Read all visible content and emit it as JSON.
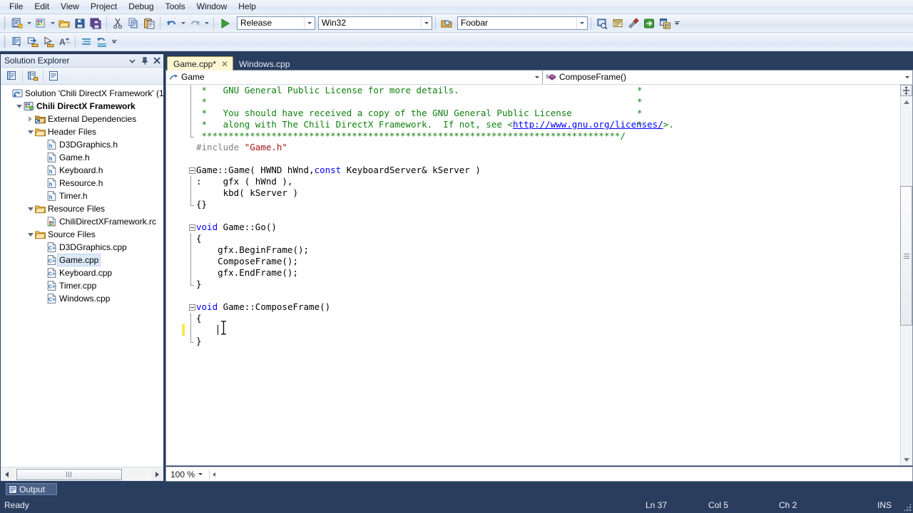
{
  "menu": {
    "items": [
      "File",
      "Edit",
      "View",
      "Project",
      "Debug",
      "Tools",
      "Window",
      "Help"
    ]
  },
  "toolbar": {
    "config_combo": "Release",
    "platform_combo": "Win32",
    "target_combo": "Foobar",
    "icons": [
      "new-project-icon",
      "add-new-item-icon",
      "open-file-icon",
      "save-icon",
      "save-all-icon",
      "cut-icon",
      "copy-icon",
      "paste-icon",
      "undo-icon",
      "redo-icon",
      "start-debug-icon",
      "find-in-files-icon",
      "properties-window-icon",
      "tools-icon",
      "go-to-icon",
      "toolbox-icon"
    ],
    "row2_icons": [
      "display-members-icon",
      "insert-snippet-icon",
      "surround-with-icon",
      "uncomment-icon",
      "comment-out-icon",
      "increase-indent-icon",
      "decrease-indent-icon"
    ]
  },
  "solution_explorer": {
    "title": "Solution Explorer",
    "window_buttons": [
      "dropdown-menu-icon",
      "pin-icon",
      "close-icon"
    ],
    "toolbar_icons": [
      "properties-icon",
      "show-all-files-icon",
      "view-code-icon"
    ],
    "tree": [
      {
        "label": "Solution 'Chili DirectX Framework' (1",
        "indent": 0,
        "expander": "none",
        "icon": "solution-icon",
        "bold": false,
        "selected": false
      },
      {
        "label": "Chili DirectX Framework",
        "indent": 1,
        "expander": "open",
        "icon": "project-icon",
        "bold": true,
        "selected": false
      },
      {
        "label": "External Dependencies",
        "indent": 2,
        "expander": "closed",
        "icon": "external-deps-folder-icon",
        "bold": false,
        "selected": false
      },
      {
        "label": "Header Files",
        "indent": 2,
        "expander": "open",
        "icon": "folder-icon",
        "bold": false,
        "selected": false
      },
      {
        "label": "D3DGraphics.h",
        "indent": 3,
        "expander": "none",
        "icon": "header-file-icon",
        "bold": false,
        "selected": false
      },
      {
        "label": "Game.h",
        "indent": 3,
        "expander": "none",
        "icon": "header-file-icon",
        "bold": false,
        "selected": false
      },
      {
        "label": "Keyboard.h",
        "indent": 3,
        "expander": "none",
        "icon": "header-file-icon",
        "bold": false,
        "selected": false
      },
      {
        "label": "Resource.h",
        "indent": 3,
        "expander": "none",
        "icon": "header-file-icon",
        "bold": false,
        "selected": false
      },
      {
        "label": "Timer.h",
        "indent": 3,
        "expander": "none",
        "icon": "header-file-icon",
        "bold": false,
        "selected": false
      },
      {
        "label": "Resource Files",
        "indent": 2,
        "expander": "open",
        "icon": "folder-icon",
        "bold": false,
        "selected": false
      },
      {
        "label": "ChiliDirectXFramework.rc",
        "indent": 3,
        "expander": "none",
        "icon": "resource-file-icon",
        "bold": false,
        "selected": false
      },
      {
        "label": "Source Files",
        "indent": 2,
        "expander": "open",
        "icon": "folder-icon",
        "bold": false,
        "selected": false
      },
      {
        "label": "D3DGraphics.cpp",
        "indent": 3,
        "expander": "none",
        "icon": "cpp-file-icon",
        "bold": false,
        "selected": false
      },
      {
        "label": "Game.cpp",
        "indent": 3,
        "expander": "none",
        "icon": "cpp-file-icon",
        "bold": false,
        "selected": true
      },
      {
        "label": "Keyboard.cpp",
        "indent": 3,
        "expander": "none",
        "icon": "cpp-file-icon",
        "bold": false,
        "selected": false
      },
      {
        "label": "Timer.cpp",
        "indent": 3,
        "expander": "none",
        "icon": "cpp-file-icon",
        "bold": false,
        "selected": false
      },
      {
        "label": "Windows.cpp",
        "indent": 3,
        "expander": "none",
        "icon": "cpp-file-icon",
        "bold": false,
        "selected": false
      }
    ]
  },
  "editor": {
    "tabs": [
      {
        "label": "Game.cpp*",
        "active": true,
        "closeable": true
      },
      {
        "label": "Windows.cpp",
        "active": false,
        "closeable": false
      }
    ],
    "close_glyph": "✕",
    "nav_scope": "Game",
    "nav_member": "ComposeFrame()",
    "nav_scope_icon": "class-scope-icon",
    "nav_member_icon": "method-icon",
    "zoom_level": "100 %",
    "code_lines": [
      {
        "fold": "none",
        "bar": "mid",
        "changed": false,
        "tokens": [
          {
            "t": " *   GNU General Public License for more details.",
            "c": "cm"
          }
        ],
        "right_star": true
      },
      {
        "fold": "none",
        "bar": "mid",
        "changed": false,
        "tokens": [
          {
            "t": " *",
            "c": "cm"
          }
        ],
        "right_star": true
      },
      {
        "fold": "none",
        "bar": "mid",
        "changed": false,
        "tokens": [
          {
            "t": " *   You should have received a copy of the GNU General Public License",
            "c": "cm"
          }
        ],
        "right_star": true
      },
      {
        "fold": "none",
        "bar": "mid",
        "changed": false,
        "tokens": [
          {
            "t": " *   along with The Chili DirectX Framework.  If not, see <",
            "c": "cm"
          },
          {
            "t": "http://www.gnu.org/licenses/",
            "c": "lnk"
          },
          {
            "t": ">.",
            "c": "cm"
          }
        ],
        "right_star": true
      },
      {
        "fold": "none",
        "bar": "end",
        "changed": false,
        "tokens": [
          {
            "t": " ******************************************************************************/",
            "c": "cm"
          }
        ],
        "right_star": false
      },
      {
        "fold": "none",
        "bar": "none",
        "changed": false,
        "tokens": [
          {
            "t": "#include ",
            "c": "pp"
          },
          {
            "t": "\"Game.h\"",
            "c": "str"
          }
        ],
        "right_star": false
      },
      {
        "fold": "none",
        "bar": "none",
        "changed": false,
        "tokens": [
          {
            "t": "",
            "c": "pl"
          }
        ],
        "right_star": false
      },
      {
        "fold": "open",
        "bar": "none",
        "changed": false,
        "tokens": [
          {
            "t": "Game::Game( HWND hWnd,",
            "c": "pl"
          },
          {
            "t": "const",
            "c": "kw"
          },
          {
            "t": " KeyboardServer& kServer )",
            "c": "pl"
          }
        ],
        "right_star": false
      },
      {
        "fold": "none",
        "bar": "mid",
        "changed": false,
        "tokens": [
          {
            "t": ":    gfx ( hWnd ),",
            "c": "pl"
          }
        ],
        "right_star": false
      },
      {
        "fold": "none",
        "bar": "mid",
        "changed": false,
        "tokens": [
          {
            "t": "     kbd( kServer )",
            "c": "pl"
          }
        ],
        "right_star": false
      },
      {
        "fold": "none",
        "bar": "end",
        "changed": false,
        "tokens": [
          {
            "t": "{}",
            "c": "pl"
          }
        ],
        "right_star": false
      },
      {
        "fold": "none",
        "bar": "none",
        "changed": false,
        "tokens": [
          {
            "t": "",
            "c": "pl"
          }
        ],
        "right_star": false
      },
      {
        "fold": "open",
        "bar": "none",
        "changed": false,
        "tokens": [
          {
            "t": "void",
            "c": "kw"
          },
          {
            "t": " Game::Go()",
            "c": "pl"
          }
        ],
        "right_star": false
      },
      {
        "fold": "none",
        "bar": "mid",
        "changed": false,
        "tokens": [
          {
            "t": "{",
            "c": "pl"
          }
        ],
        "right_star": false
      },
      {
        "fold": "none",
        "bar": "mid",
        "changed": false,
        "tokens": [
          {
            "t": "    gfx.BeginFrame();",
            "c": "pl"
          }
        ],
        "right_star": false
      },
      {
        "fold": "none",
        "bar": "mid",
        "changed": false,
        "tokens": [
          {
            "t": "    ComposeFrame();",
            "c": "pl"
          }
        ],
        "right_star": false
      },
      {
        "fold": "none",
        "bar": "mid",
        "changed": false,
        "tokens": [
          {
            "t": "    gfx.EndFrame();",
            "c": "pl"
          }
        ],
        "right_star": false
      },
      {
        "fold": "none",
        "bar": "end",
        "changed": false,
        "tokens": [
          {
            "t": "}",
            "c": "pl"
          }
        ],
        "right_star": false
      },
      {
        "fold": "none",
        "bar": "none",
        "changed": false,
        "tokens": [
          {
            "t": "",
            "c": "pl"
          }
        ],
        "right_star": false
      },
      {
        "fold": "open",
        "bar": "none",
        "changed": false,
        "tokens": [
          {
            "t": "void",
            "c": "kw"
          },
          {
            "t": " Game::ComposeFrame()",
            "c": "pl"
          }
        ],
        "right_star": false
      },
      {
        "fold": "none",
        "bar": "mid",
        "changed": false,
        "tokens": [
          {
            "t": "{",
            "c": "pl"
          }
        ],
        "right_star": false
      },
      {
        "fold": "none",
        "bar": "mid",
        "changed": true,
        "tokens": [
          {
            "t": "    ",
            "c": "pl"
          }
        ],
        "caret": true,
        "right_star": false
      },
      {
        "fold": "none",
        "bar": "end",
        "changed": false,
        "tokens": [
          {
            "t": "}",
            "c": "pl"
          }
        ],
        "right_star": false
      }
    ]
  },
  "bottom_dock": {
    "output_tab": "Output",
    "output_icon": "output-window-icon"
  },
  "statusbar": {
    "state": "Ready",
    "line": "Ln 37",
    "column": "Col 5",
    "character": "Ch 2",
    "insert_mode": "INS"
  },
  "colors": {
    "chrome_blue": "#2b3d5e",
    "tab_active_bg": "#fdf6d3",
    "comment_green": "#108010",
    "keyword_blue": "#0000ff",
    "string_red": "#a31515",
    "preprocessor_gray": "#808080",
    "change_marker_yellow": "#f7e84f"
  }
}
